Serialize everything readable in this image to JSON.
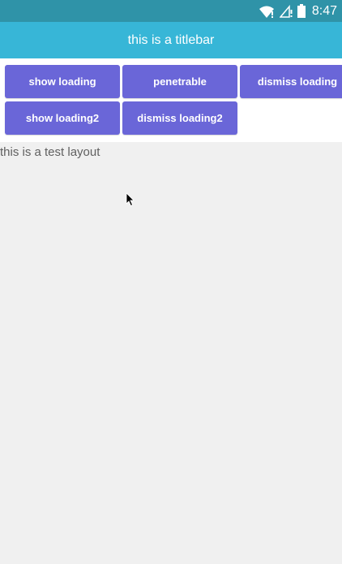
{
  "statusbar": {
    "time": "8:47",
    "icons": [
      "wifi-icon",
      "signal-icon",
      "battery-icon"
    ],
    "background": "#2f93a8"
  },
  "titlebar": {
    "title": "this is a titlebar",
    "background": "#37b6d7"
  },
  "buttons": {
    "show_loading": "show loading",
    "penetrable": "penetrable",
    "dismiss_loading": "dismiss loading",
    "show_loading2": "show loading2",
    "dismiss_loading2": "dismiss loading2",
    "color": "#6a66d8"
  },
  "content": {
    "layout_text": "this is a test layout"
  }
}
